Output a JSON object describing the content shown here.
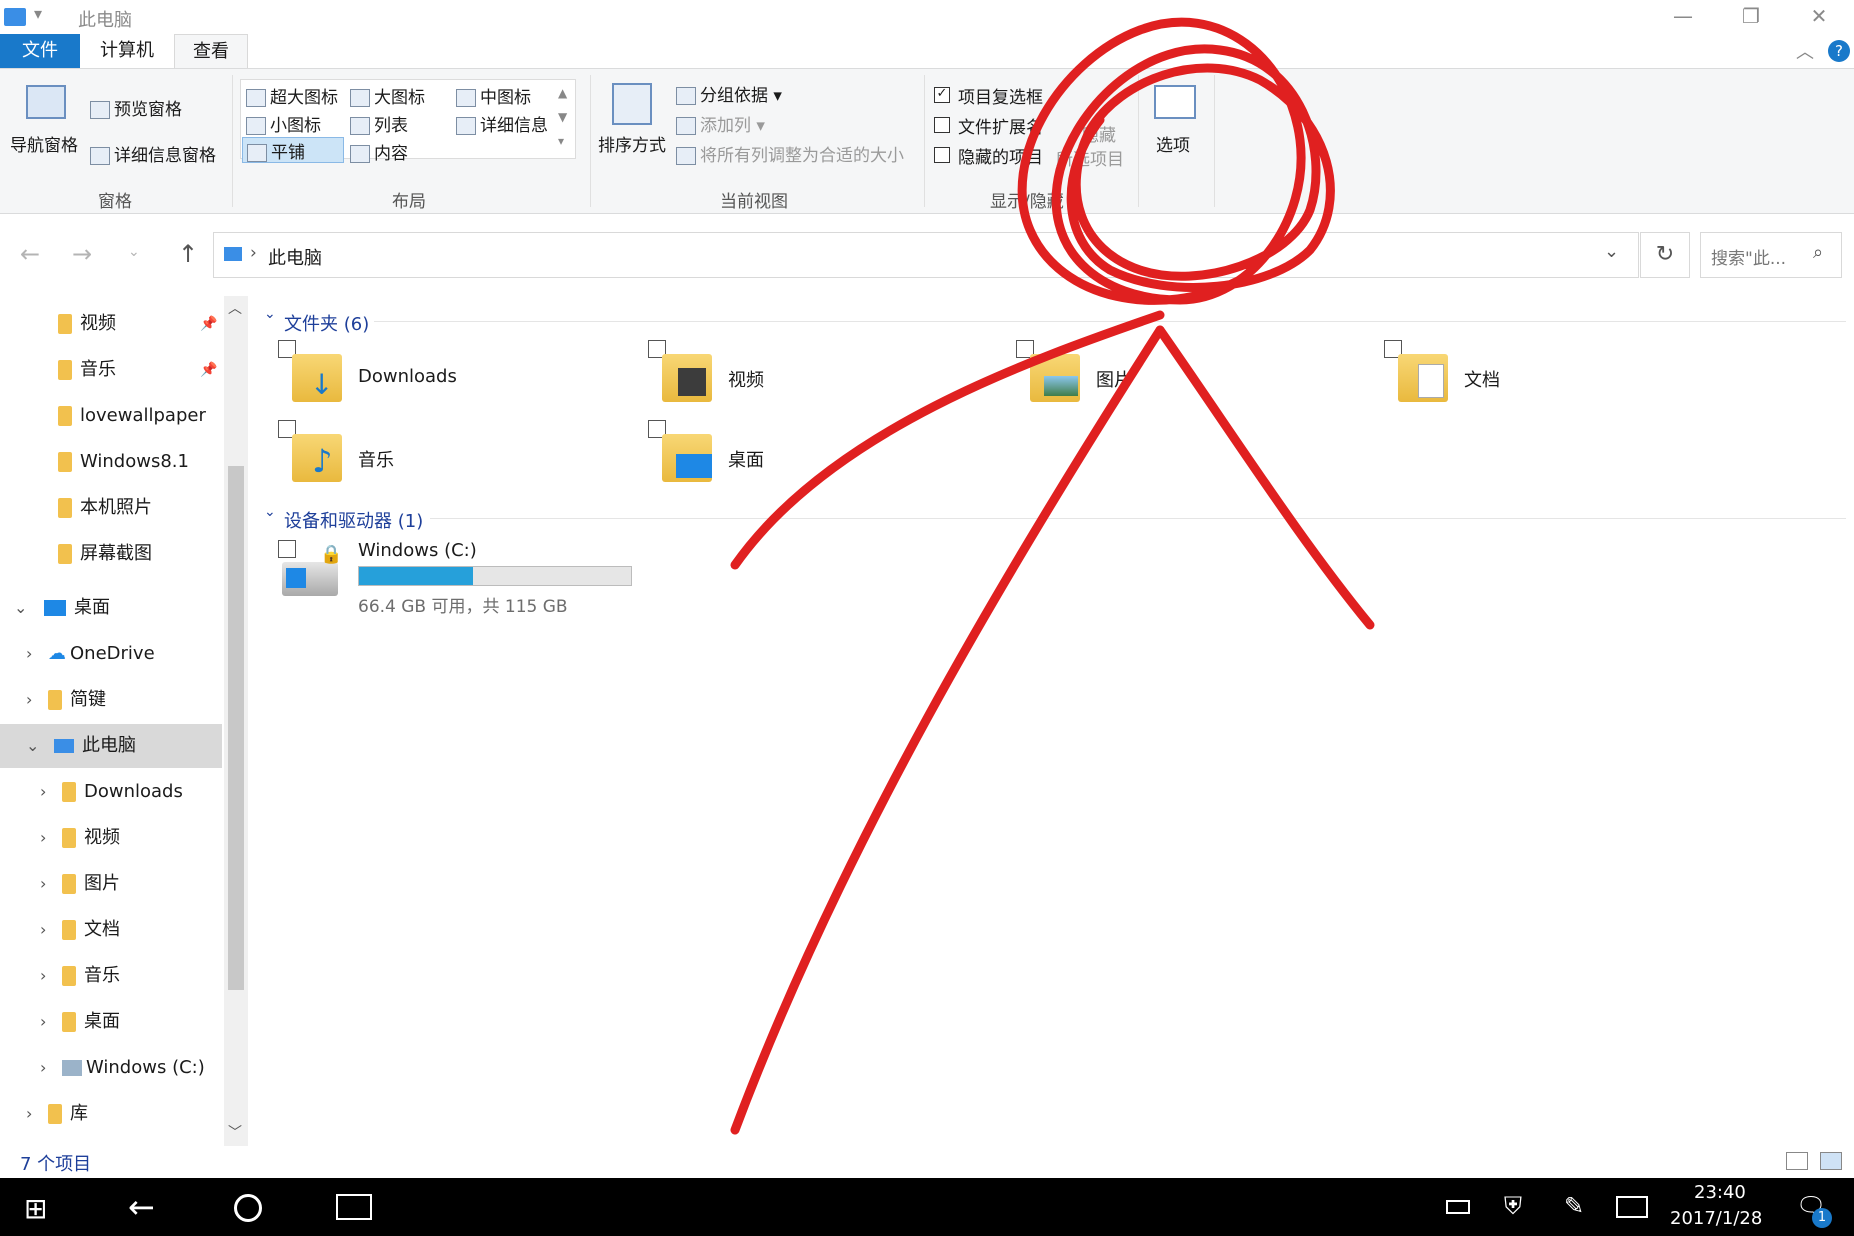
{
  "window": {
    "title": "此电脑",
    "quick_access_glyph": "▾"
  },
  "tabs": [
    {
      "label": "文件"
    },
    {
      "label": "计算机"
    },
    {
      "label": "查看"
    }
  ],
  "ribbon": {
    "pane": {
      "nav_pane": "导航窗格",
      "preview_pane": "预览窗格",
      "details_pane": "详细信息窗格",
      "group": "窗格"
    },
    "layout": {
      "items": [
        "超大图标",
        "大图标",
        "中图标",
        "小图标",
        "列表",
        "详细信息",
        "平铺",
        "内容"
      ],
      "group": "布局"
    },
    "current_view": {
      "sort": "排序方式",
      "group_by": "分组依据",
      "add_column": "添加列",
      "fit_columns": "将所有列调整为合适的大小",
      "group": "当前视图"
    },
    "show_hide": {
      "item_checkboxes": "项目复选框",
      "file_extensions": "文件扩展名",
      "hidden_items": "隐藏的项目",
      "hide_selected_1": "隐藏",
      "hide_selected_2": "所选项目",
      "group": "显示/隐藏"
    },
    "options": "选项"
  },
  "address": {
    "path": "此电脑",
    "search_placeholder": "搜索\"此..."
  },
  "sidebar": {
    "items": [
      {
        "label": "视频",
        "pinned": true
      },
      {
        "label": "音乐",
        "pinned": true
      },
      {
        "label": "lovewallpaper"
      },
      {
        "label": "Windows8.1"
      },
      {
        "label": "本机照片"
      },
      {
        "label": "屏幕截图"
      },
      {
        "label": "桌面"
      },
      {
        "label": "OneDrive"
      },
      {
        "label": "简键"
      },
      {
        "label": "此电脑"
      },
      {
        "label": "Downloads"
      },
      {
        "label": "视频"
      },
      {
        "label": "图片"
      },
      {
        "label": "文档"
      },
      {
        "label": "音乐"
      },
      {
        "label": "桌面"
      },
      {
        "label": "Windows (C:)"
      },
      {
        "label": "库"
      }
    ]
  },
  "content": {
    "folders_header": "文件夹 (6)",
    "folders": [
      {
        "name": "Downloads"
      },
      {
        "name": "视频"
      },
      {
        "name": "图片"
      },
      {
        "name": "文档"
      },
      {
        "name": "音乐"
      },
      {
        "name": "桌面"
      }
    ],
    "drives_header": "设备和驱动器 (1)",
    "drive": {
      "name": "Windows (C:)",
      "free_text": "66.4 GB 可用，共 115 GB",
      "used_fraction": 0.42
    }
  },
  "status": {
    "count": "7 个项目"
  },
  "taskbar": {
    "time": "23:40",
    "date": "2017/1/28",
    "notif_count": "1"
  },
  "colors": {
    "accent": "#1979ca",
    "annotation": "#e02020"
  }
}
